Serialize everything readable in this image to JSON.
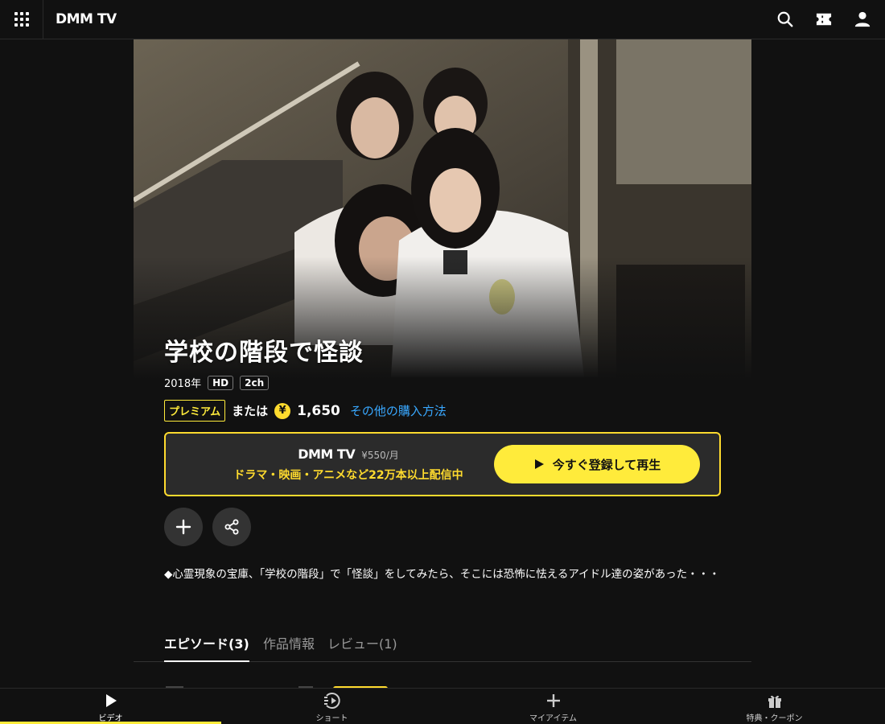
{
  "header": {
    "logo": "DMM TV",
    "icons": [
      "grid-menu-icon",
      "search-icon",
      "ticket-icon",
      "user-icon"
    ]
  },
  "title": "学校の階段で怪談",
  "meta": {
    "year": "2018年",
    "tags": [
      "HD",
      "2ch"
    ]
  },
  "price": {
    "premium_label": "プレミアム",
    "or_label": "または",
    "coin_symbol": "¥",
    "amount": "1,650",
    "other_link": "その他の購入方法"
  },
  "promo": {
    "logo": "DMM TV",
    "monthly_price": "¥550/月",
    "subtitle": "ドラマ・映画・アニメなど22万本以上配信中",
    "button_label": "今すぐ登録して再生"
  },
  "actions": [
    "add-icon",
    "share-icon"
  ],
  "description": "◆心霊現象の宝庫、「学校の階段」で「怪談」をしてみたら、そこには恐怖に怯えるアイドル達の姿があった・・・",
  "tabs": [
    {
      "label": "エピソード(3)",
      "active": true
    },
    {
      "label": "作品情報",
      "active": false
    },
    {
      "label": "レビュー(1)",
      "active": false
    }
  ],
  "bottom_nav": [
    {
      "label": "ビデオ",
      "icon": "play-icon",
      "active": true
    },
    {
      "label": "ショート",
      "icon": "short-play-icon",
      "active": false
    },
    {
      "label": "マイアイテム",
      "icon": "plus-icon",
      "active": false
    },
    {
      "label": "特典・クーポン",
      "icon": "gift-icon",
      "active": false
    }
  ],
  "colors": {
    "accent": "#ffeb3b",
    "link": "#39a8ff",
    "background": "#111111"
  }
}
